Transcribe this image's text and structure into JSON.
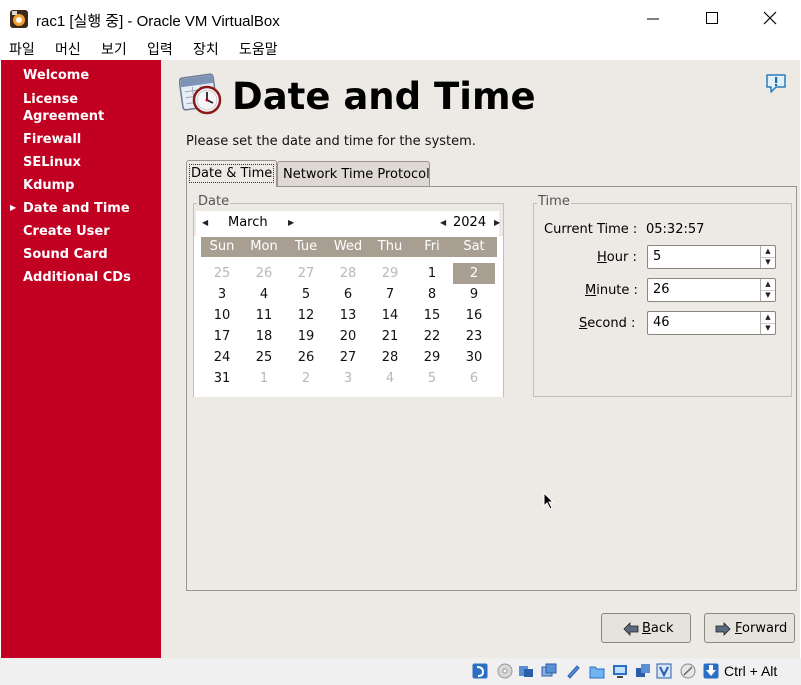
{
  "window": {
    "title": "rac1 [실행 중] - Oracle VM VirtualBox",
    "controls": [
      "minimize",
      "maximize",
      "close"
    ]
  },
  "menubar": {
    "items": [
      "파일",
      "머신",
      "보기",
      "입력",
      "장치",
      "도움말"
    ]
  },
  "sidebar": {
    "current_index": 5,
    "items": [
      {
        "label": "Welcome"
      },
      {
        "label": "License Agreement",
        "lines": [
          "License",
          "Agreement"
        ]
      },
      {
        "label": "Firewall"
      },
      {
        "label": "SELinux"
      },
      {
        "label": "Kdump"
      },
      {
        "label": "Date and Time"
      },
      {
        "label": "Create User"
      },
      {
        "label": "Sound Card"
      },
      {
        "label": "Additional CDs"
      }
    ]
  },
  "page": {
    "title": "Date and Time",
    "instructions": "Please set the date and time for the system.",
    "tabs": [
      {
        "label": "Date & Time",
        "active": true
      },
      {
        "label": "Network Time Protocol",
        "active": false
      }
    ]
  },
  "date_frame": {
    "label": "Date",
    "month": "March",
    "year": "2024",
    "weekdays": [
      "Sun",
      "Mon",
      "Tue",
      "Wed",
      "Thu",
      "Fri",
      "Sat"
    ],
    "selected_day": "2",
    "weeks": [
      [
        "25",
        "26",
        "27",
        "28",
        "29",
        "1",
        "2"
      ],
      [
        "3",
        "4",
        "5",
        "6",
        "7",
        "8",
        "9"
      ],
      [
        "10",
        "11",
        "12",
        "13",
        "14",
        "15",
        "16"
      ],
      [
        "17",
        "18",
        "19",
        "20",
        "21",
        "22",
        "23"
      ],
      [
        "24",
        "25",
        "26",
        "27",
        "28",
        "29",
        "30"
      ],
      [
        "31",
        "1",
        "2",
        "3",
        "4",
        "5",
        "6"
      ]
    ],
    "outside_month": [
      [
        true,
        true,
        true,
        true,
        true,
        false,
        false
      ],
      [
        false,
        false,
        false,
        false,
        false,
        false,
        false
      ],
      [
        false,
        false,
        false,
        false,
        false,
        false,
        false
      ],
      [
        false,
        false,
        false,
        false,
        false,
        false,
        false
      ],
      [
        false,
        false,
        false,
        false,
        false,
        false,
        false
      ],
      [
        false,
        true,
        true,
        true,
        true,
        true,
        true
      ]
    ]
  },
  "time_frame": {
    "label": "Time",
    "current_label": "Current Time :",
    "current_value": "05:32:57",
    "hour_label": "Hour :",
    "hour": "5",
    "minute_label": "Minute :",
    "minute": "26",
    "second_label": "Second :",
    "second": "46"
  },
  "buttons": {
    "back": "Back",
    "forward": "Forward"
  },
  "statusbar": {
    "host_key": "Ctrl + Alt",
    "icons": [
      "optical-drive-icon",
      "audio-icon",
      "usb-icon",
      "network-icon",
      "shared-folder-icon",
      "folder-icon",
      "display-icon",
      "recording-icon",
      "cpu-virtualization-icon",
      "mouse-integration-icon",
      "host-key-arrow-icon"
    ]
  },
  "colors": {
    "sidebar": "#c20022",
    "background": "#edeae5",
    "calendar_header": "#a89f92"
  }
}
